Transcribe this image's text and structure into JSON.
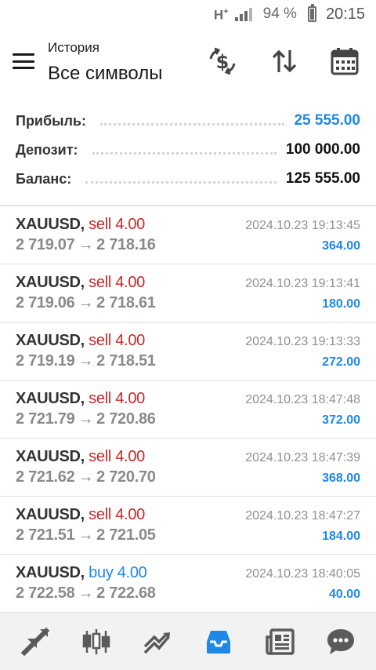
{
  "status_bar": {
    "network": "H",
    "network_sup": "+",
    "battery": "94 %",
    "time": "20:15"
  },
  "header": {
    "subtitle": "История",
    "title": "Все символы",
    "icons": [
      "currency-exchange-icon",
      "sort-icon",
      "calendar-icon"
    ]
  },
  "summary": {
    "profit_label": "Прибыль:",
    "profit_value": "25 555.00",
    "deposit_label": "Депозит:",
    "deposit_value": "100 000.00",
    "balance_label": "Баланс:",
    "balance_value": "125 555.00"
  },
  "trades": [
    {
      "symbol": "XAUUSD",
      "type": "sell 4.00",
      "side": "sell",
      "open": "2 719.07",
      "close": "2 718.16",
      "time": "2024.10.23 19:13:45",
      "profit": "364.00"
    },
    {
      "symbol": "XAUUSD",
      "type": "sell 4.00",
      "side": "sell",
      "open": "2 719.06",
      "close": "2 718.61",
      "time": "2024.10.23 19:13:41",
      "profit": "180.00"
    },
    {
      "symbol": "XAUUSD",
      "type": "sell 4.00",
      "side": "sell",
      "open": "2 719.19",
      "close": "2 718.51",
      "time": "2024.10.23 19:13:33",
      "profit": "272.00"
    },
    {
      "symbol": "XAUUSD",
      "type": "sell 4.00",
      "side": "sell",
      "open": "2 721.79",
      "close": "2 720.86",
      "time": "2024.10.23 18:47:48",
      "profit": "372.00"
    },
    {
      "symbol": "XAUUSD",
      "type": "sell 4.00",
      "side": "sell",
      "open": "2 721.62",
      "close": "2 720.70",
      "time": "2024.10.23 18:47:39",
      "profit": "368.00"
    },
    {
      "symbol": "XAUUSD",
      "type": "sell 4.00",
      "side": "sell",
      "open": "2 721.51",
      "close": "2 721.05",
      "time": "2024.10.23 18:47:27",
      "profit": "184.00"
    },
    {
      "symbol": "XAUUSD",
      "type": "buy 4.00",
      "side": "buy",
      "open": "2 722.58",
      "close": "2 722.68",
      "time": "2024.10.23 18:40:05",
      "profit": "40.00"
    }
  ],
  "arrow_glyph": "→",
  "bottom_nav": {
    "items": [
      "quotes-icon",
      "chart-icon",
      "trade-icon",
      "history-icon",
      "news-icon",
      "chat-icon"
    ],
    "active": "history-icon"
  },
  "colors": {
    "accent": "#1e88e5",
    "sell": "#c62828",
    "buy": "#1e88e5",
    "nav_icon": "#5a5a5a"
  }
}
